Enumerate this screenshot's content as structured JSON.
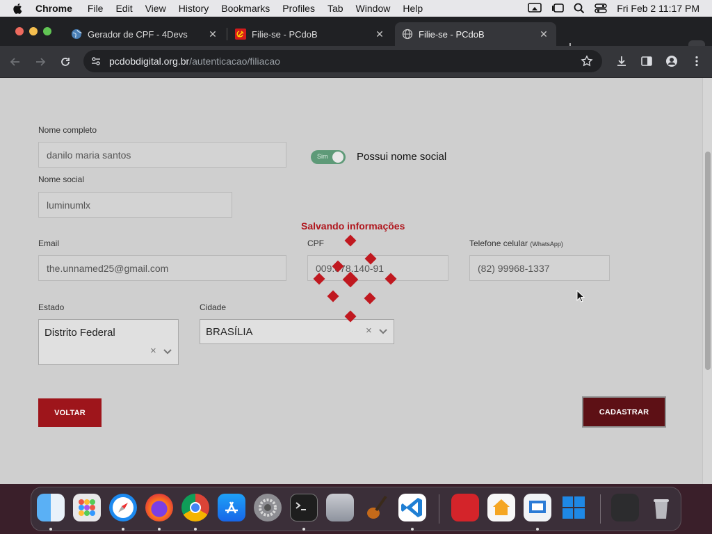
{
  "menubar": {
    "app_name": "Chrome",
    "items": [
      "File",
      "Edit",
      "View",
      "History",
      "Bookmarks",
      "Profiles",
      "Tab",
      "Window",
      "Help"
    ],
    "clock": "Fri Feb 2  11:17 PM"
  },
  "tabs": [
    {
      "title": "Gerador de CPF - 4Devs",
      "icon": "globe-icon"
    },
    {
      "title": "Filie-se - PCdoB",
      "icon": "hammer-sickle-icon"
    },
    {
      "title": "Filie-se - PCdoB",
      "icon": "globe-icon",
      "active": true
    }
  ],
  "address_bar": {
    "host": "pcdobdigital.org.br",
    "path": "/autenticacao/filiacao"
  },
  "form": {
    "full_name": {
      "label": "Nome completo",
      "value": "danilo maria santos"
    },
    "social_toggle": {
      "state_label": "Sim",
      "label": "Possui nome social",
      "on": true
    },
    "social_name": {
      "label": "Nome social",
      "value": "luminumlx"
    },
    "email": {
      "label": "Email",
      "value": "the.unnamed25@gmail.com"
    },
    "cpf": {
      "label": "CPF",
      "value": "009.078.140-91"
    },
    "phone": {
      "label": "Telefone celular",
      "label_note": "(WhatsApp)",
      "value": "(82) 99968-1337"
    },
    "state": {
      "label": "Estado",
      "value": "Distrito Federal",
      "clear": "×"
    },
    "city": {
      "label": "Cidade",
      "value": "BRASÍLIA",
      "clear": "×"
    },
    "loading_text": "Salvando informações",
    "back_button": "VOLTAR",
    "submit_button": "CADASTRAR"
  },
  "colors": {
    "brand_red": "#9e151b",
    "submit_dark_red": "#5d1015",
    "toggle_green": "#5e9a78",
    "loader_red": "#c0181f"
  },
  "dock": {
    "apps": [
      "finder-icon",
      "launchpad-icon",
      "safari-icon",
      "firefox-icon",
      "chrome-icon",
      "app-store-icon",
      "system-settings-icon",
      "terminal-icon",
      "migration-assistant-icon",
      "garageband-icon",
      "vscode-icon",
      "photo-booth-icon",
      "home-icon",
      "remote-desktop-icon",
      "windows-app-icon",
      "downloads-stack-icon",
      "trash-icon"
    ]
  }
}
